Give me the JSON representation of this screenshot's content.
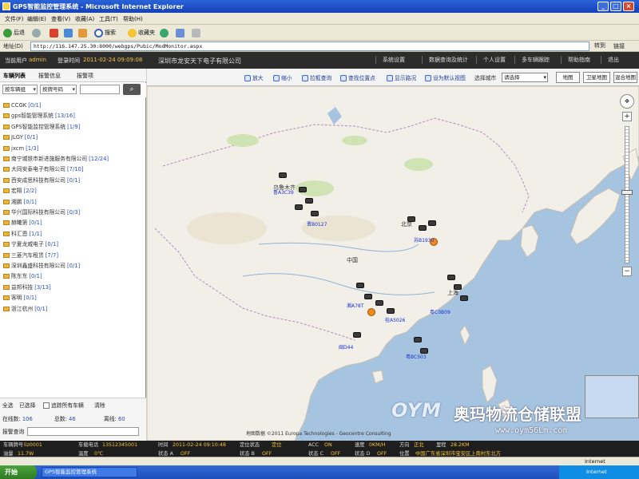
{
  "window": {
    "title": "GPS智能监控管理系统 - Microsoft Internet Explorer"
  },
  "ie_menu": [
    "文件(F)",
    "编辑(E)",
    "查看(V)",
    "收藏(A)",
    "工具(T)",
    "帮助(H)"
  ],
  "ie_toolbar": {
    "back": "后退",
    "search": "搜索",
    "favorites": "收藏夹"
  },
  "address": {
    "label": "地址(D)",
    "url": "http://116.147.25.30:8000/webgps/Pubic/ModMonitor.aspx",
    "go": "转到",
    "links": "链接"
  },
  "app_header": {
    "user_label": "当前用户",
    "user": "admin",
    "time_label": "登录时间",
    "time": "2011-02-24 09:09:08",
    "company": "深圳市龙安天下电子有限公司",
    "nav": [
      "系统设置",
      "数据查询及统计",
      "个人设置",
      "多车辆跟踪",
      "帮助指南",
      "退出"
    ]
  },
  "left_panel": {
    "tabs": [
      "车辆列表",
      "报警信息",
      "报警项"
    ],
    "filter1": "按车辆组",
    "filter2": "按牌号码",
    "tree": [
      {
        "name": "CCGK",
        "count": "[0/1]"
      },
      {
        "name": "gps智能管理系统",
        "count": "[13/16]"
      },
      {
        "name": "GPS智能监控管理系统",
        "count": "[1/9]"
      },
      {
        "name": "JLGY",
        "count": "[0/1]"
      },
      {
        "name": "jxcm",
        "count": "[1/3]"
      },
      {
        "name": "南宁城铁市新进施服务有限公司",
        "count": "[12/24]"
      },
      {
        "name": "大同安泰电子有限公司",
        "count": "[7/10]"
      },
      {
        "name": "西安成思科技有限公司",
        "count": "[0/1]"
      },
      {
        "name": "宏翔",
        "count": "[2/2]"
      },
      {
        "name": "湘鹏",
        "count": "[0/1]"
      },
      {
        "name": "华兴国际科技有限公司",
        "count": "[0/3]"
      },
      {
        "name": "赫曦第",
        "count": "[0/1]"
      },
      {
        "name": "科汇恩",
        "count": "[1/1]"
      },
      {
        "name": "宁夏龙威电子",
        "count": "[0/1]"
      },
      {
        "name": "三菱汽车租赁",
        "count": "[7/7]"
      },
      {
        "name": "深圳鑫盛科技有限公司",
        "count": "[0/1]"
      },
      {
        "name": "陈东东",
        "count": "[0/1]"
      },
      {
        "name": "益邦科技",
        "count": "[3/13]"
      },
      {
        "name": "客明",
        "count": "[0/1]"
      },
      {
        "name": "浙江杭州",
        "count": "[0/1]"
      }
    ],
    "footer": {
      "select_all": "全选",
      "all_selected": "已选择",
      "track_all": "追踪所有车辆",
      "clear": "清除",
      "online_label": "在线数",
      "online": "106",
      "total_label": "总数",
      "total": "46",
      "alarm_label": "离线",
      "alarm": "60",
      "query_label": "报警查询"
    }
  },
  "map_tools": {
    "items": [
      "放大",
      "缩小",
      "拉框查询",
      "查找位置点",
      "显示路况",
      "设为默认视图"
    ],
    "city_label": "选择城市",
    "city_value": "请选择",
    "btn_map": "地图",
    "btn_satellite": "卫星地图",
    "btn_hybrid": "混合地图",
    "zoom": "+",
    "zoom_out": "−"
  },
  "map": {
    "labels": [
      "中国",
      "乌鲁木齐",
      "北京",
      "上海"
    ],
    "copyright": "地图数据 ©2011 Europa Technologies - Geocentre Consulting",
    "car_labels": [
      "鲁A3C39",
      "晋B0127",
      "粤BCS03",
      "湘A78T",
      "苏B1930",
      "粤C0B09",
      "桂A5026",
      "闽D44"
    ]
  },
  "watermark": {
    "logo": "OYM",
    "cn": "奥玛物流仓储联盟",
    "url": "www.oym56Lm.com"
  },
  "status_row1": {
    "vehicle_label": "车辆牌号",
    "vehicle": "liz0001",
    "sim_label": "车载电话",
    "sim": "13512345001",
    "time_label": "时间",
    "time": "2011-02-24 09:10:48",
    "locate_label": "定位状态",
    "locate": "定位",
    "acc_label": "ACC",
    "acc": "ON",
    "speed_label": "速度",
    "speed": "0KM/H",
    "dir_label": "方向",
    "dir": "正北",
    "mileage_label": "里程",
    "mileage": "28.2KM"
  },
  "status_row2": {
    "oil_label": "油量",
    "oil": "11.7W",
    "temp_label": "温度",
    "temp": "0℃",
    "s_a_label": "状态 A",
    "s_a": "OFF",
    "s_b_label": "状态 B",
    "s_b": "OFF",
    "s_c_label": "状态 C",
    "s_c": "OFF",
    "s_d_label": "状态 D",
    "s_d": "OFF",
    "pos_label": "位置",
    "pos": "中国广东省深圳市宝安区上南村东北方"
  },
  "ie_status": {
    "zone": "Internet"
  },
  "taskbar": {
    "start": "开始",
    "task": "GPS智能监控管理系统"
  },
  "colors": {
    "header": "#2c2c2c",
    "title_bar": "#2a63d8",
    "map_sea": "#a6c4e0",
    "map_land": "#f2efe8",
    "accent": "#f2c33a"
  }
}
